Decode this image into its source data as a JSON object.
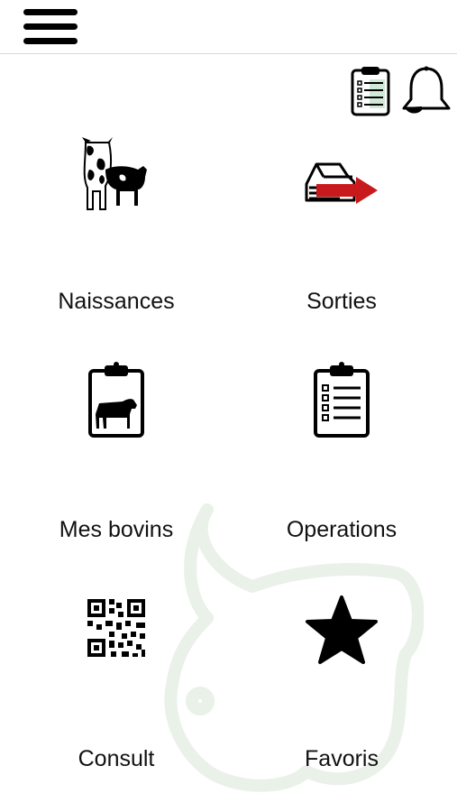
{
  "header": {
    "menu_icon": "hamburger-menu-icon"
  },
  "toolbar": {
    "checklist_icon": "clipboard-checklist-icon",
    "notification_icon": "bell-icon"
  },
  "tiles": [
    {
      "label": "Naissances",
      "icon": "cow-and-calf-icon"
    },
    {
      "label": "Sorties",
      "icon": "barn-exit-arrow-icon"
    },
    {
      "label": "Mes bovins",
      "icon": "clipboard-cow-icon"
    },
    {
      "label": "Operations",
      "icon": "clipboard-list-icon"
    },
    {
      "label": "Consult",
      "icon": "qr-code-icon"
    },
    {
      "label": "Favoris",
      "icon": "star-icon"
    }
  ],
  "colors": {
    "accent_red": "#c8191c",
    "watermark": "#e9f1e9",
    "checklist_green": "#4fae7a"
  }
}
